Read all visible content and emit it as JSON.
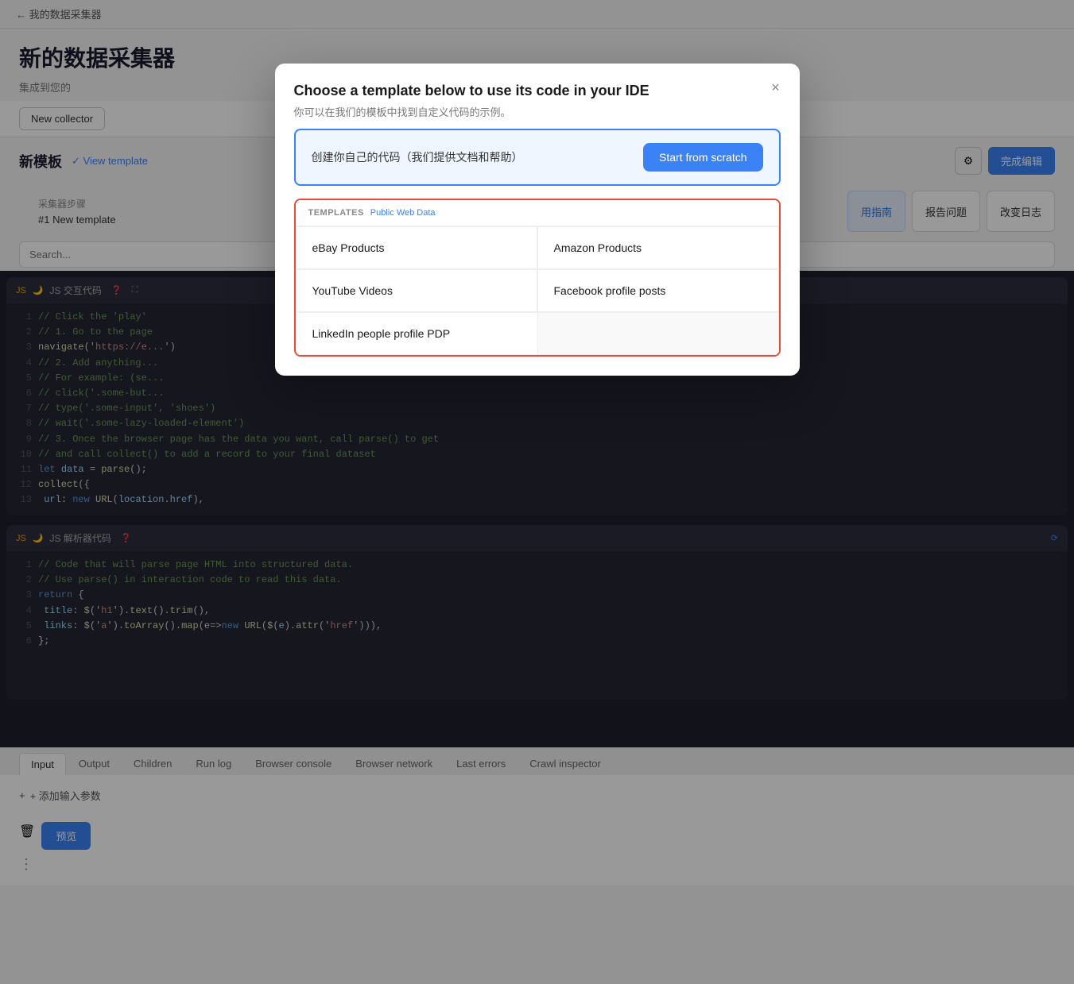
{
  "nav": {
    "back_label": "← 我的数据采集器"
  },
  "page": {
    "title": "新的数据采集器",
    "subtitle": "集成到您的",
    "new_collector_btn": "New collector"
  },
  "section": {
    "title": "新模板",
    "view_template_label": "✓ View template",
    "complete_btn": "完成编辑",
    "steps_label": "采集器步骤",
    "step_name": "#1  New template"
  },
  "action_buttons": [
    {
      "label": "用指南"
    },
    {
      "label": "报告问题"
    },
    {
      "label": "改变日志"
    }
  ],
  "search_placeholder": "Search...",
  "editor": {
    "interaction_title": "JS 交互代码",
    "interaction_lines": [
      "// Click the 'play'",
      "// 1. Go to the page",
      "navigate('https://e...",
      "// 2. Add anything...",
      "// For example: (se...",
      "// click('.some-but...",
      "// type('.some-input', 'shoes')",
      "// wait('.some-lazy-loaded-element')",
      "// 3. Once the browser page has the data you want, call parse() to get",
      "// and call collect() to add a record to your final dataset",
      "let data = parse();",
      "collect({",
      "   url: new URL(location.href),"
    ],
    "parser_title": "JS 解析器代码",
    "parser_lines": [
      "// Code that will parse page HTML into structured data.",
      "// Use parse() in interaction code to read this data.",
      "return {",
      "  title: $('h1').text().trim(),",
      "  links: $('a').toArray().map(e=>new URL($(e).attr('href'))),",
      "};"
    ]
  },
  "bottom_tabs": [
    {
      "label": "Input",
      "active": true
    },
    {
      "label": "Output"
    },
    {
      "label": "Children"
    },
    {
      "label": "Run log"
    },
    {
      "label": "Browser console"
    },
    {
      "label": "Browser network"
    },
    {
      "label": "Last errors"
    },
    {
      "label": "Crawl inspector"
    }
  ],
  "bottom_panel": {
    "add_param_label": "+ 添加输入参数",
    "preview_btn": "预览",
    "delete_icon": "🗑"
  },
  "modal": {
    "title": "Choose a template below to use its code in your IDE",
    "subtitle": "你可以在我们的模板中找到自定义代码的示例。",
    "close_icon": "×",
    "scratch_box": {
      "text": "创建你自己的代码（我们提供文档和帮助）",
      "button_label": "Start from scratch"
    },
    "templates_section": {
      "label": "TEMPLATES",
      "tag": "Public Web Data",
      "items": [
        {
          "label": "eBay Products"
        },
        {
          "label": "Amazon Products"
        },
        {
          "label": "YouTube Videos"
        },
        {
          "label": "Facebook profile posts"
        },
        {
          "label": "LinkedIn people profile PDP"
        }
      ]
    }
  }
}
